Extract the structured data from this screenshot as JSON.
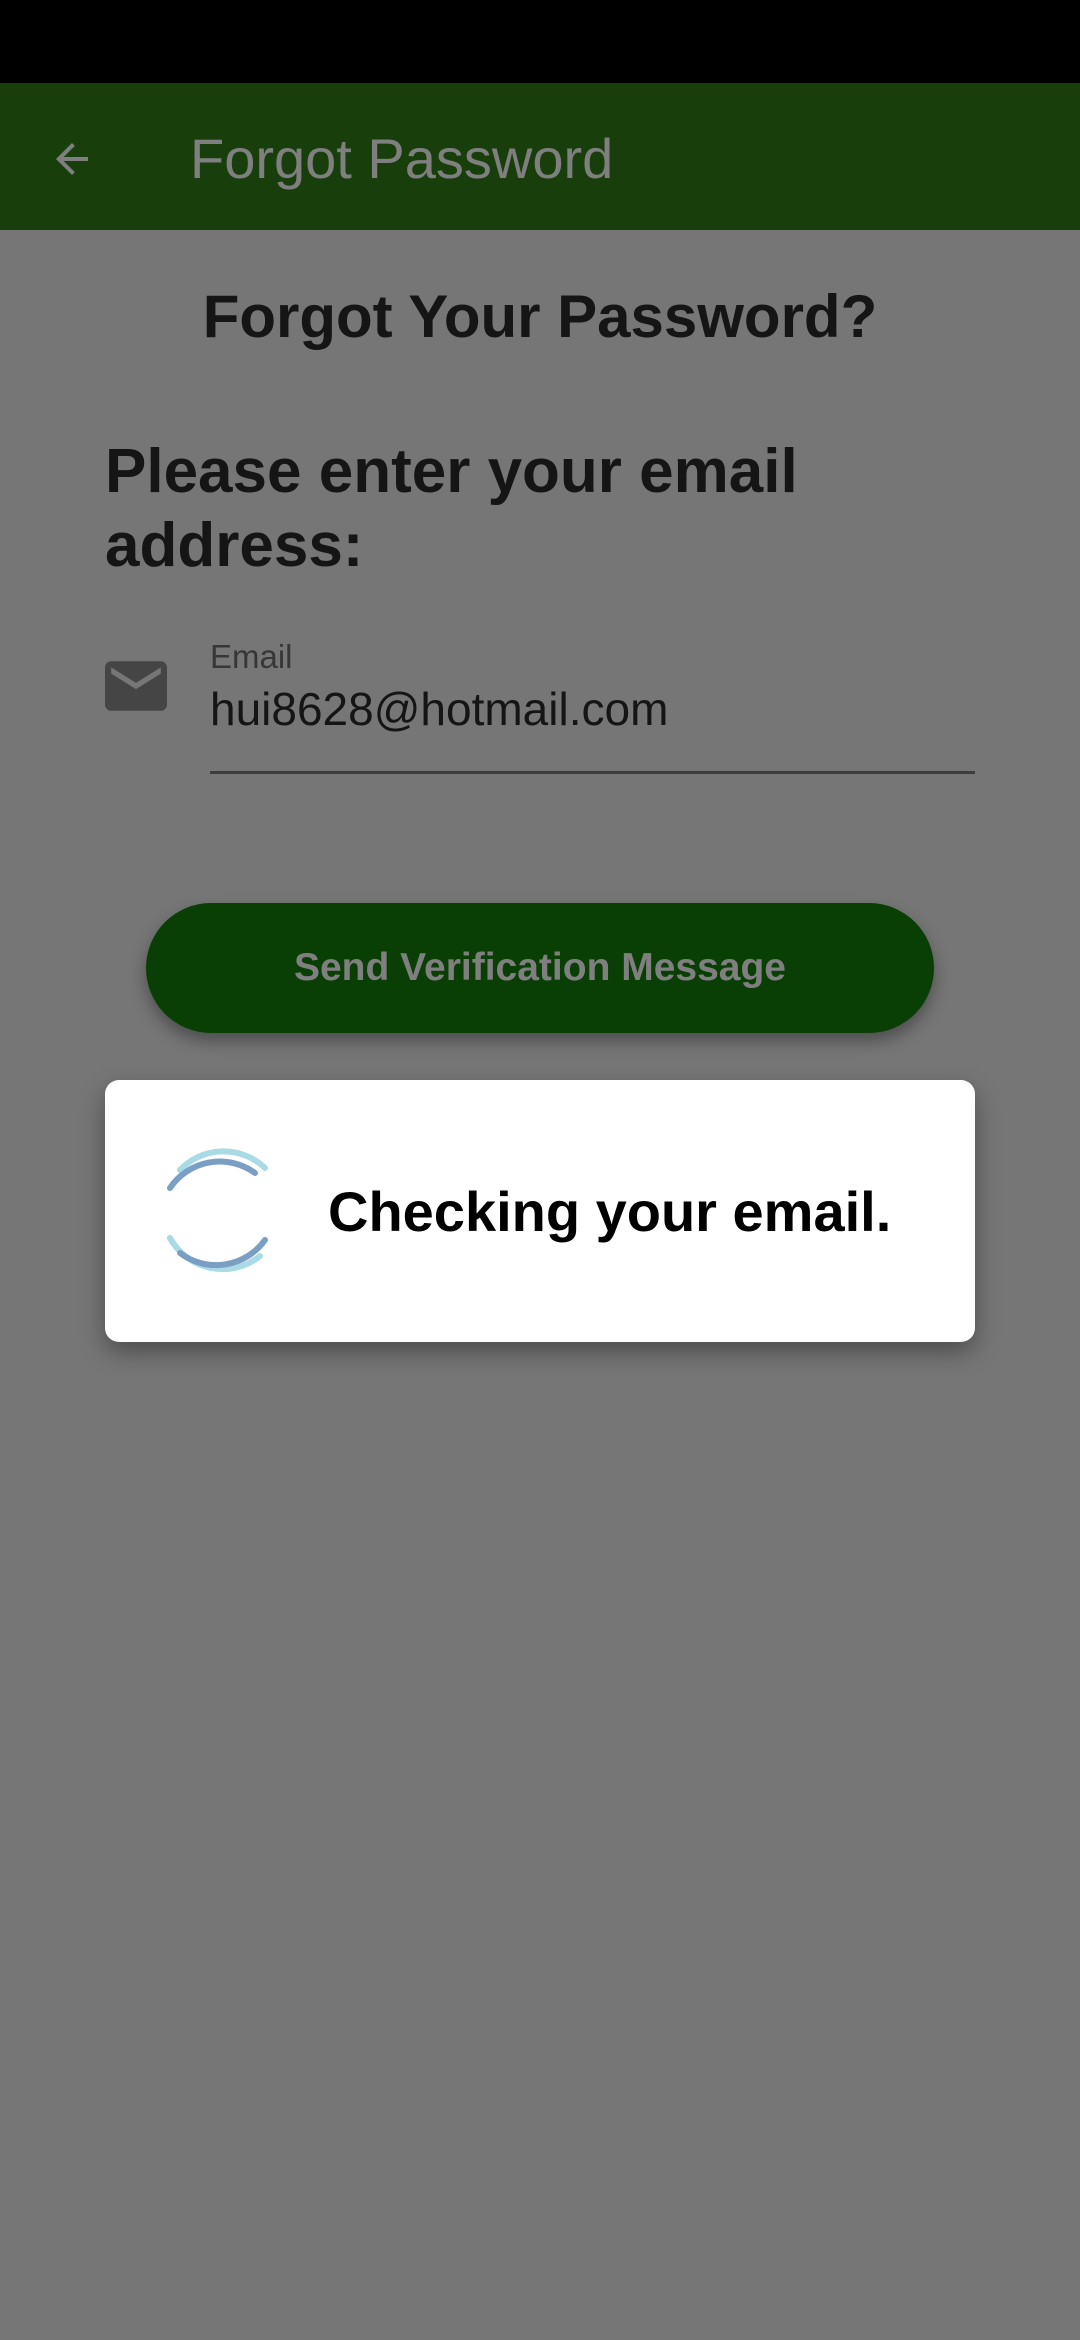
{
  "app_bar": {
    "title": "Forgot Password",
    "back_icon": "arrow-back-icon",
    "background": "#2e7d16"
  },
  "form": {
    "heading": "Forgot Your Password?",
    "prompt": "Please enter your email address:",
    "email_icon": "mail-icon",
    "email_label": "Email",
    "email_value": "hui8628@hotmail.com",
    "send_button_label": "Send Verification Message",
    "button_color": "#127d09"
  },
  "dialog": {
    "message": "Checking your email.",
    "spinner_icon": "loading-spinner-icon"
  }
}
